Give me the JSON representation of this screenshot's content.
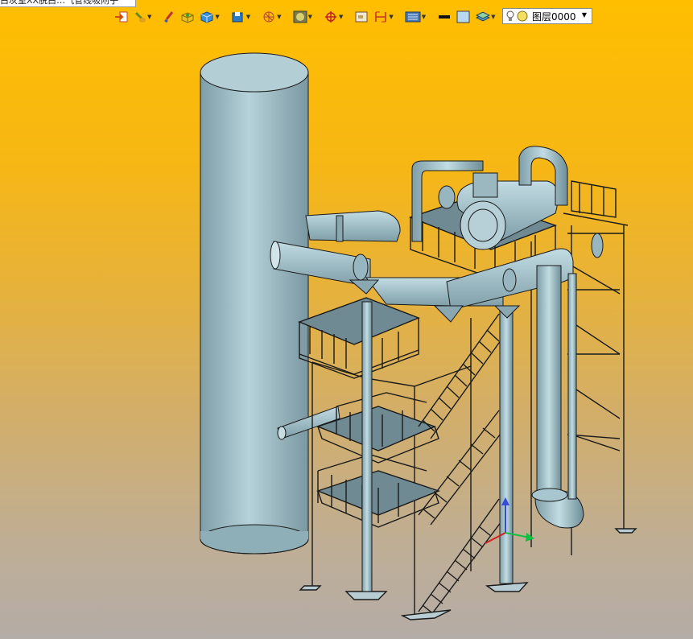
{
  "document_tab": {
    "title": "白灰室XX脱白…气管线吸附子"
  },
  "toolbar": {
    "tools": [
      {
        "icon": "import-icon"
      },
      {
        "icon": "shovel-icon"
      },
      {
        "icon": "brush-icon"
      },
      {
        "icon": "box-yellow-icon"
      },
      {
        "icon": "cube-blue-icon"
      },
      {
        "icon": "view-cube-icon"
      },
      {
        "icon": "orbit-icon"
      },
      {
        "icon": "shading-icon"
      },
      {
        "icon": "crosshair-icon"
      },
      {
        "icon": "grid-icon"
      },
      {
        "icon": "dimension-icon"
      },
      {
        "icon": "display-icon"
      },
      {
        "icon": "line-weight-icon"
      },
      {
        "icon": "color-swatch-icon"
      },
      {
        "icon": "layers-icon"
      }
    ]
  },
  "layer_select": {
    "value": "图层0000"
  },
  "colors": {
    "background_top": "#ffbe00",
    "background_bottom": "#b4aca6",
    "model_steel": "#a7c6cf",
    "model_edge": "#1a1a1a"
  }
}
